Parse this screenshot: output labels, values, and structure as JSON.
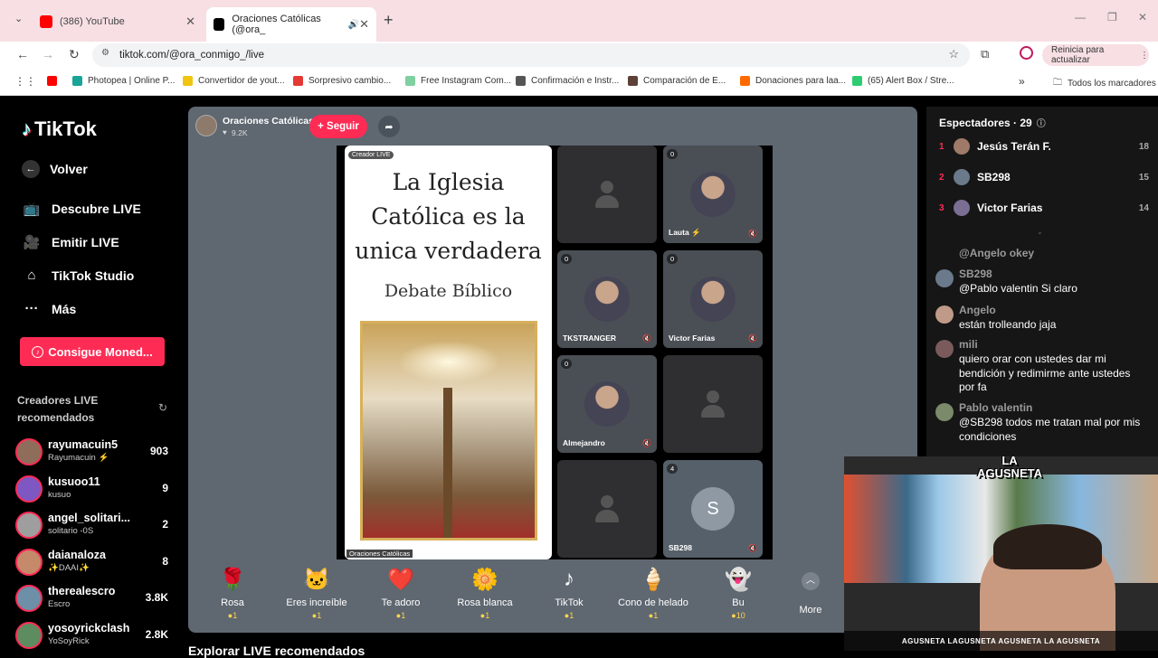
{
  "browser": {
    "tabs": [
      {
        "title": "(386) YouTube",
        "favicon_color": "#ff0000"
      },
      {
        "title": "Oraciones Católicas (@ora_",
        "favicon_color": "#000000"
      }
    ],
    "url": "tiktok.com/@ora_conmigo_/live",
    "update_label": "Reinicia para actualizar",
    "bookmarks": [
      {
        "label": "",
        "color": "#ff0000"
      },
      {
        "label": "Photopea | Online P...",
        "color": "#18a497"
      },
      {
        "label": "Convertidor de yout...",
        "color": "#f1c40f"
      },
      {
        "label": "Sorpresivo cambio...",
        "color": "#e53935"
      },
      {
        "label": "Free Instagram Com...",
        "color": "#7fd0a0"
      },
      {
        "label": "Confirmación e Instr...",
        "color": "#555555"
      },
      {
        "label": "Comparación de E...",
        "color": "#5d4037"
      },
      {
        "label": "Donaciones para laa...",
        "color": "#ff6a00"
      },
      {
        "label": "(65) Alert Box / Stre...",
        "color": "#2ecc71"
      }
    ],
    "all_bookmarks": "Todos los marcadores"
  },
  "sidebar": {
    "logo": "TikTok",
    "back": "Volver",
    "nav": [
      "Descubre LIVE",
      "Emitir LIVE",
      "TikTok Studio",
      "Más"
    ],
    "coins_button": "Consigue Moned...",
    "recommended_title": "Creadores LIVE recomendados",
    "creators": [
      {
        "name": "rayumacuin5",
        "sub": "Rayumacuin ⚡",
        "count": "903",
        "color": "#8e6e5a"
      },
      {
        "name": "kusuoo11",
        "sub": "kusuo",
        "count": "9",
        "color": "#7e57c2"
      },
      {
        "name": "angel_solitari...",
        "sub": "solitario -0S",
        "count": "2",
        "color": "#9e9e9e"
      },
      {
        "name": "daianaloza",
        "sub": "✨DAAI✨",
        "count": "8",
        "color": "#c48a6a"
      },
      {
        "name": "therealescro",
        "sub": "Escro",
        "count": "3.8K",
        "color": "#6d8fa8"
      },
      {
        "name": "yosoyrickclash",
        "sub": "YoSoyRick",
        "count": "2.8K",
        "color": "#5e8c61"
      }
    ]
  },
  "live": {
    "host_name": "Oraciones Católicas",
    "host_likes": "9.2K",
    "follow_label": "+ Seguir",
    "creator_badge": "Creador LIVE",
    "slide_title": "La Iglesia Católica es la unica verdadera",
    "slide_subtitle": "Debate Bíblico",
    "host_footer": "Oraciones Católicas",
    "tiles": [
      {
        "name": "",
        "badge": ""
      },
      {
        "name": "Lauta ⚡",
        "badge": "0"
      },
      {
        "name": "TKSTRANGER",
        "badge": "0"
      },
      {
        "name": "Victor Farias",
        "badge": "0"
      },
      {
        "name": "Almejandro",
        "badge": "0"
      },
      {
        "name": "",
        "badge": ""
      },
      {
        "name": "",
        "badge": ""
      },
      {
        "name": "SB298",
        "badge": "4",
        "initial": "S"
      }
    ]
  },
  "gifts": [
    {
      "name": "Rosa",
      "cost": "1",
      "icon": "🌹"
    },
    {
      "name": "Eres increíble",
      "cost": "1",
      "icon": "🐱"
    },
    {
      "name": "Te adoro",
      "cost": "1",
      "icon": "❤️"
    },
    {
      "name": "Rosa blanca",
      "cost": "1",
      "icon": "🌼"
    },
    {
      "name": "TikTok",
      "cost": "1",
      "icon": "♪"
    },
    {
      "name": "Cono de helado",
      "cost": "1",
      "icon": "🍦"
    },
    {
      "name": "Bu",
      "cost": "10",
      "icon": "👻"
    }
  ],
  "gifts_more": "More",
  "viewers": {
    "title": "Espectadores · 29",
    "list": [
      {
        "rank": "1",
        "name": "Jesús Terán F.",
        "count": "18"
      },
      {
        "rank": "2",
        "name": "SB298",
        "count": "15"
      },
      {
        "rank": "3",
        "name": "Victor Farias",
        "count": "14"
      }
    ]
  },
  "chat": [
    {
      "user": "@Angelo okey",
      "text": ""
    },
    {
      "user": "SB298",
      "text": "@Pablo valentin Si claro"
    },
    {
      "user": "Angelo",
      "text": "están trolleando jaja"
    },
    {
      "user": "mili",
      "text": "quiero orar con ustedes dar mi bendición y redimirme ante ustedes por fa"
    },
    {
      "user": "Pablo valentin",
      "text": "@SB298 todos me tratan mal por mis condiciones"
    }
  ],
  "overlay": {
    "logo": "LA AGUSNETA",
    "socials": "AGUSNETA  LAGUSNETA  AGUSNETA  LA AGUSNETA"
  },
  "bottom_text": "Explorar LIVE recomendados"
}
